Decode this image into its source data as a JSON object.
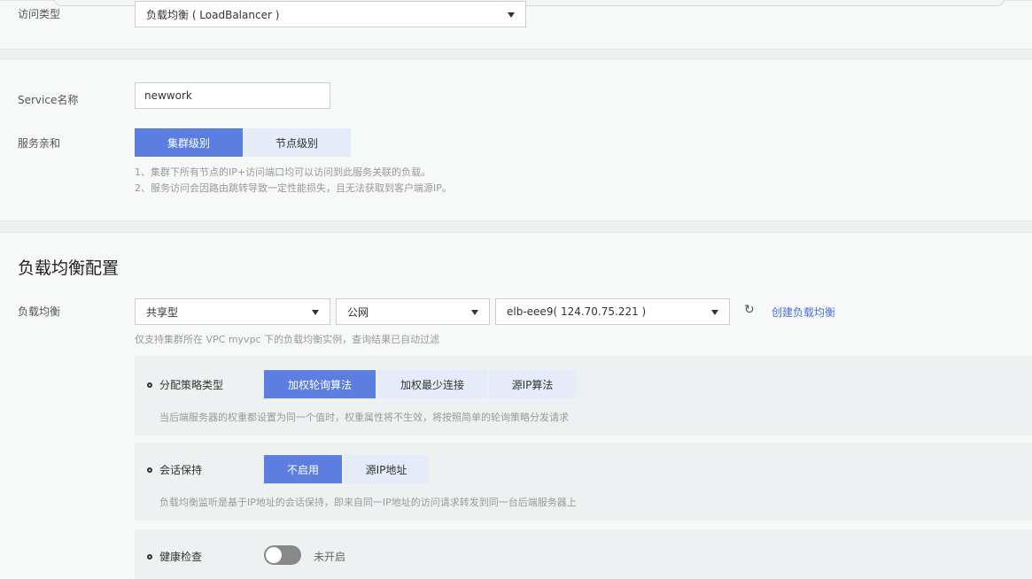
{
  "access": {
    "label": "访问类型",
    "value": "负载均衡 ( LoadBalancer )"
  },
  "service": {
    "name_label": "Service名称",
    "name_value": "newwork",
    "affinity_label": "服务亲和",
    "affinity_options": [
      "集群级别",
      "节点级别"
    ],
    "affinity_selected": 0,
    "notes": [
      "1、集群下所有节点的IP+访问端口均可以访问到此服务关联的负载。",
      "2、服务访问会因路由跳转导致一定性能损失，且无法获取到客户端源IP。"
    ]
  },
  "lb": {
    "section_title": "负载均衡配置",
    "label": "负载均衡",
    "type_value": "共享型",
    "network_value": "公网",
    "instance_value": "elb-eee9( 124.70.75.221 )",
    "create_link": "创建负载均衡",
    "refresh_icon": "refresh-icon",
    "filter_hint": "仅支持集群所在 VPC myvpc 下的负载均衡实例，查询结果已自动过滤",
    "strategy": {
      "label": "分配策略类型",
      "options": [
        "加权轮询算法",
        "加权最少连接",
        "源IP算法"
      ],
      "selected": 0,
      "hint": "当后端服务器的权重都设置为同一个值时，权重属性将不生效，将按照简单的轮询策略分发请求"
    },
    "session": {
      "label": "会话保持",
      "options": [
        "不启用",
        "源IP地址"
      ],
      "selected": 0,
      "hint": "负载均衡监听是基于IP地址的会话保持，即来自同一IP地址的访问请求转发到同一台后端服务器上"
    },
    "health": {
      "label": "健康检查",
      "status": "未开启",
      "enabled": false
    }
  },
  "colors": {
    "accent": "#5b7ee0",
    "accent_light": "#e5ebf8",
    "link": "#4a70d8"
  }
}
